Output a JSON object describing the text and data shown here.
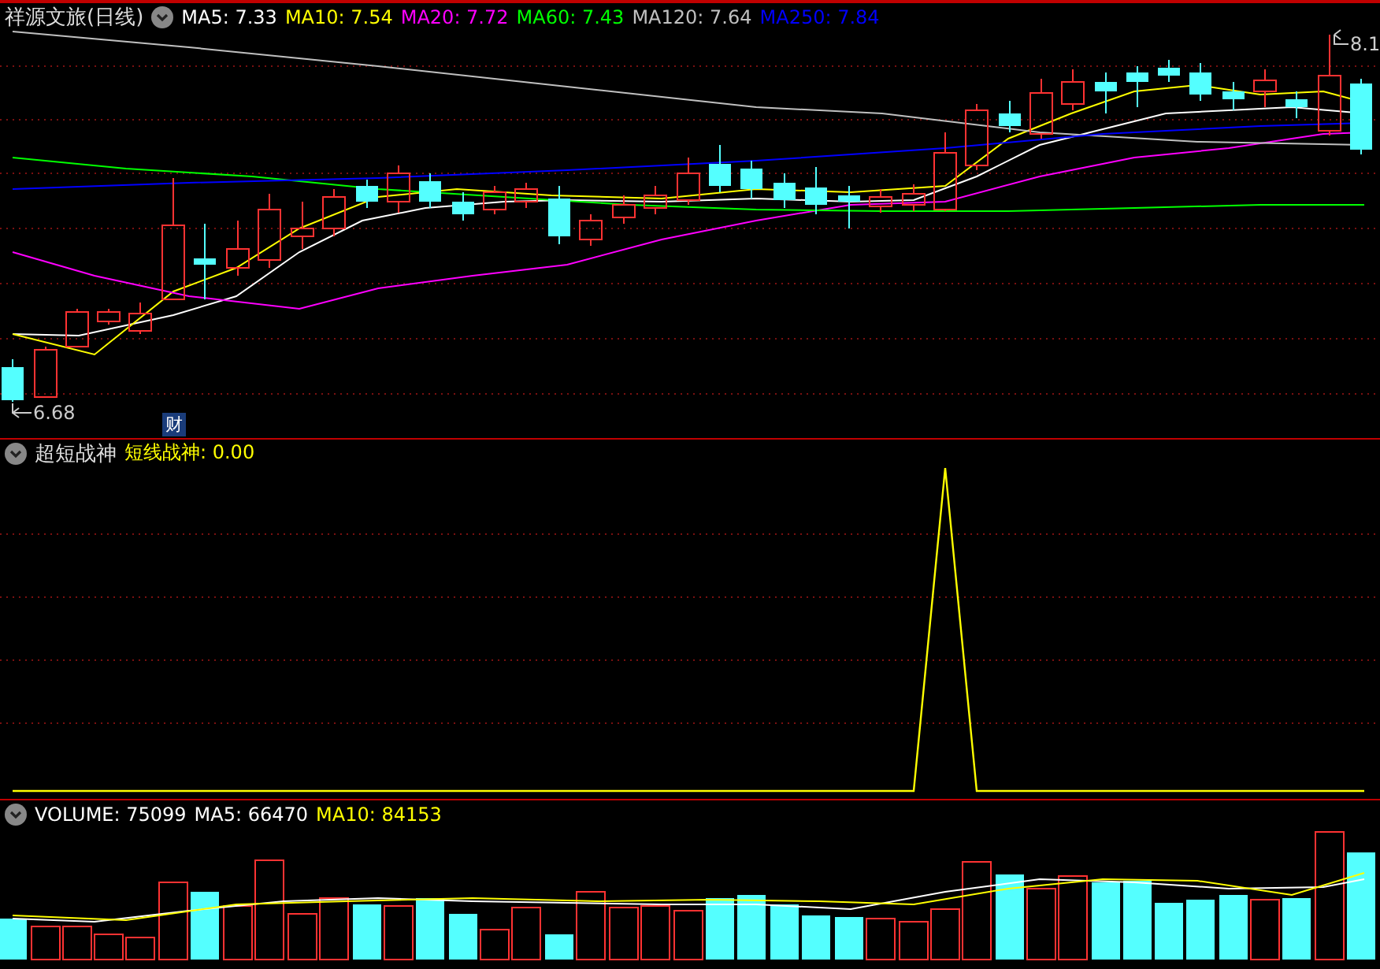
{
  "price_panel": {
    "title": "祥源文旅(日线)",
    "moving_averages": [
      {
        "label": "MA5:",
        "value": "7.33",
        "color": "#ffffff"
      },
      {
        "label": "MA10:",
        "value": "7.54",
        "color": "#ffff00"
      },
      {
        "label": "MA20:",
        "value": "7.72",
        "color": "#ff00ff"
      },
      {
        "label": "MA60:",
        "value": "7.43",
        "color": "#00ff00"
      },
      {
        "label": "MA120:",
        "value": "7.64",
        "color": "#c0c0c0"
      },
      {
        "label": "MA250:",
        "value": "7.84",
        "color": "#0000ff"
      }
    ],
    "low_marker": "6.68",
    "high_marker": "8.1",
    "event_badge": "财"
  },
  "indicator_panel": {
    "name": "超短战神",
    "series_label": "短线战神:",
    "series_value": "0.00"
  },
  "volume_panel": {
    "legend": [
      {
        "label": "VOLUME:",
        "value": "75099",
        "color": "#ffffff"
      },
      {
        "label": "MA5:",
        "value": "66470",
        "color": "#ffffff"
      },
      {
        "label": "MA10:",
        "value": "84153",
        "color": "#ffff00"
      }
    ]
  }
}
